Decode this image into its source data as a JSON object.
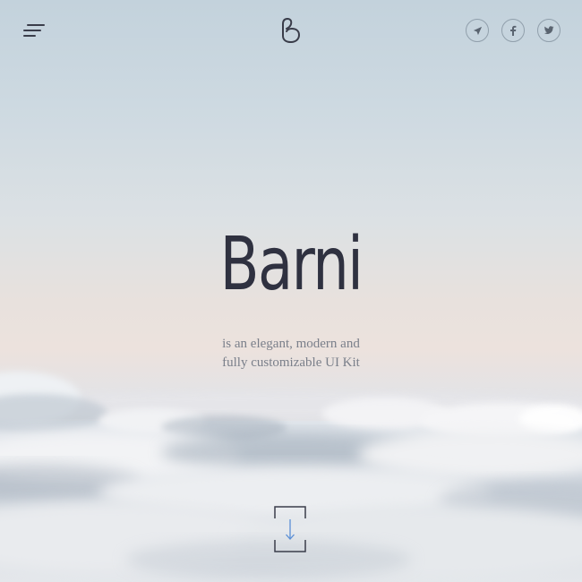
{
  "header": {
    "menu_icon": "hamburger-menu-icon",
    "logo_icon": "barni-logo-icon",
    "social": [
      {
        "name": "telegram",
        "icon": "paper-plane-icon"
      },
      {
        "name": "facebook",
        "icon": "facebook-icon"
      },
      {
        "name": "twitter",
        "icon": "twitter-icon"
      }
    ]
  },
  "hero": {
    "title": "Barni",
    "subtitle_line1": "is an elegant, modern and",
    "subtitle_line2": "fully customizable UI Kit",
    "scroll_icon": "arrow-down-icon"
  },
  "colors": {
    "title": "#2f3140",
    "subtitle": "#7a7f8a",
    "accent_arrow": "#5b8fd6",
    "sky_top": "#c3d2dc",
    "sky_horizon": "#ece2dd"
  }
}
